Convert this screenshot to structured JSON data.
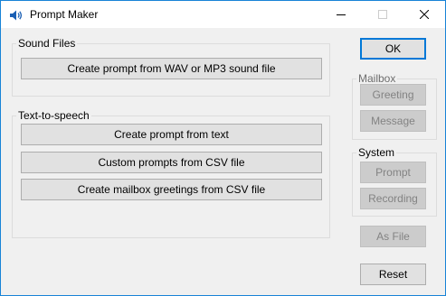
{
  "window": {
    "title": "Prompt Maker",
    "app_icon": "speaker-icon",
    "controls": [
      "minimize-icon",
      "maximize-icon",
      "close-icon"
    ]
  },
  "sound_files": {
    "legend": "Sound Files",
    "create_from_sound_file_label": "Create prompt from WAV or MP3 sound file"
  },
  "text_to_speech": {
    "legend": "Text-to-speech",
    "create_from_text_label": "Create prompt from text",
    "custom_csv_label": "Custom prompts from CSV file",
    "mailbox_greetings_csv_label": "Create mailbox greetings from CSV file"
  },
  "side": {
    "ok_label": "OK",
    "mailbox": {
      "legend": "Mailbox",
      "greeting_label": "Greeting",
      "message_label": "Message"
    },
    "system": {
      "legend": "System",
      "prompt_label": "Prompt",
      "recording_label": "Recording"
    },
    "as_file_label": "As File",
    "reset_label": "Reset"
  },
  "colors": {
    "accent": "#0078d7",
    "window_border": "#1883d7",
    "face": "#f0f0f0",
    "button": "#e1e1e1",
    "disabled_text": "#838383"
  }
}
